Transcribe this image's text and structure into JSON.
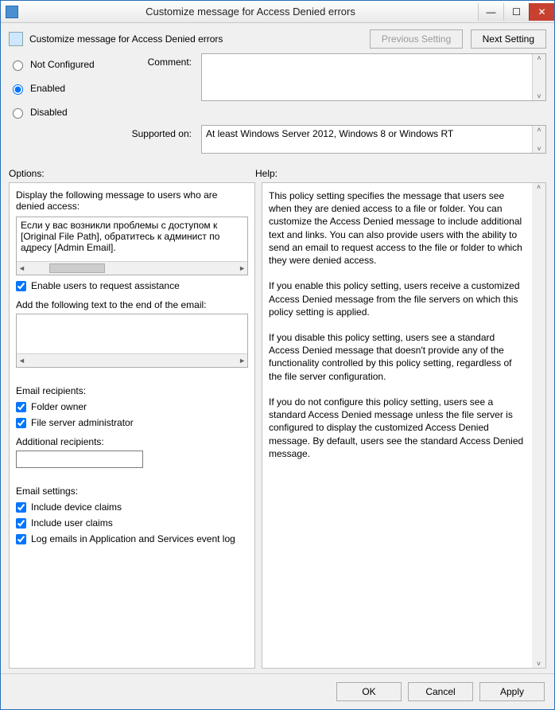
{
  "window": {
    "title": "Customize message for Access Denied errors"
  },
  "header": {
    "subtitle": "Customize message for Access Denied errors",
    "prev_btn": "Previous Setting",
    "next_btn": "Next Setting"
  },
  "state": {
    "not_configured": "Not Configured",
    "enabled": "Enabled",
    "disabled": "Disabled",
    "selected": "enabled"
  },
  "labels": {
    "comment": "Comment:",
    "supported": "Supported on:",
    "options": "Options:",
    "help": "Help:"
  },
  "supported_text": "At least Windows Server 2012, Windows 8 or Windows RT",
  "options": {
    "display_msg_label": "Display the following message to users who are denied access:",
    "display_msg_value": "Если у вас возникли проблемы с доступом к [Original File Path], обратитесь к админист по адресу [Admin Email].",
    "enable_assist": "Enable users to request assistance",
    "enable_assist_checked": true,
    "add_email_text_label": "Add the following text to the end of the email:",
    "add_email_text_value": "",
    "email_recipients_label": "Email recipients:",
    "folder_owner": "Folder owner",
    "folder_owner_checked": true,
    "fs_admin": "File server administrator",
    "fs_admin_checked": true,
    "additional_recipients_label": "Additional recipients:",
    "additional_recipients_value": "",
    "email_settings_label": "Email settings:",
    "include_device": "Include device claims",
    "include_device_checked": true,
    "include_user": "Include user claims",
    "include_user_checked": true,
    "log_emails": "Log emails in Application and Services event log",
    "log_emails_checked": true
  },
  "help": {
    "p1": "This policy setting specifies the message that users see when they are denied access to a file or folder. You can customize the Access Denied message to include additional text and links. You can also provide users with the ability to send an email to request access to the file or folder to which they were denied access.",
    "p2": "If you enable this policy setting, users receive a customized Access Denied message from the file servers on which this policy setting is applied.",
    "p3": "If you disable this policy setting, users see a standard Access Denied message that doesn't provide any of the functionality controlled by this policy setting, regardless of the file server configuration.",
    "p4": "If you do not configure this policy setting, users see a standard Access Denied message unless the file server is configured to display the customized Access Denied message. By default, users see the standard Access Denied message."
  },
  "footer": {
    "ok": "OK",
    "cancel": "Cancel",
    "apply": "Apply"
  }
}
